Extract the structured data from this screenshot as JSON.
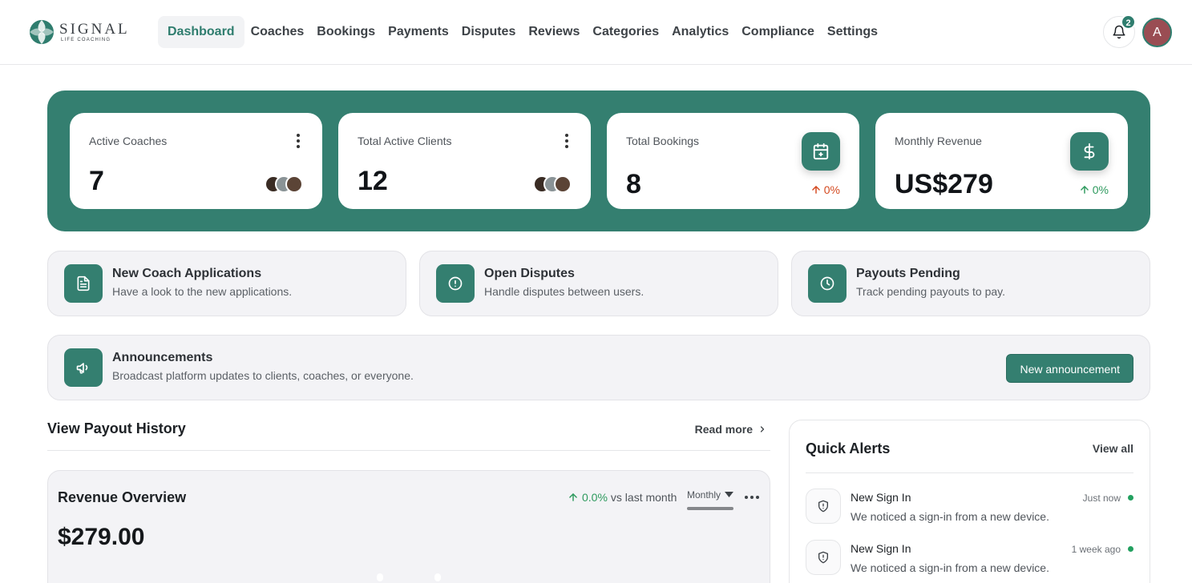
{
  "brand": {
    "name": "SIGNAL",
    "tagline": "LIFE COACHING"
  },
  "nav": {
    "items": [
      {
        "label": "Dashboard",
        "active": true
      },
      {
        "label": "Coaches"
      },
      {
        "label": "Bookings"
      },
      {
        "label": "Payments"
      },
      {
        "label": "Disputes"
      },
      {
        "label": "Reviews"
      },
      {
        "label": "Categories"
      },
      {
        "label": "Analytics"
      },
      {
        "label": "Compliance"
      },
      {
        "label": "Settings"
      }
    ]
  },
  "header": {
    "notifications_count": "2",
    "avatar_initial": "A",
    "accent_color": "#347f70"
  },
  "stats": [
    {
      "label": "Active Coaches",
      "value": "7",
      "kind": "avatars"
    },
    {
      "label": "Total Active Clients",
      "value": "12",
      "kind": "avatars"
    },
    {
      "label": "Total Bookings",
      "value": "8",
      "icon": "calendar-plus-icon",
      "delta": "0%",
      "delta_color": "#d4491f"
    },
    {
      "label": "Monthly Revenue",
      "value": "US$279",
      "icon": "dollar-icon",
      "delta": "0%",
      "delta_color": "#2e9a5e"
    }
  ],
  "actions": [
    {
      "title": "New Coach Applications",
      "description": "Have a look to the new applications.",
      "icon": "document-icon"
    },
    {
      "title": "Open Disputes",
      "description": "Handle disputes between users.",
      "icon": "alert-circle-icon"
    },
    {
      "title": "Payouts Pending",
      "description": "Track pending payouts to pay.",
      "icon": "clock-icon"
    }
  ],
  "announcements": {
    "title": "Announcements",
    "description": "Broadcast platform updates to clients, coaches, or everyone.",
    "button_label": "New announcement",
    "icon": "megaphone-icon"
  },
  "payout_history": {
    "title": "View Payout History",
    "link_label": "Read more"
  },
  "revenue_overview": {
    "title": "Revenue Overview",
    "amount": "$279.00",
    "delta": "0.0%",
    "delta_suffix": "vs last month",
    "period": "Monthly"
  },
  "quick_alerts": {
    "title": "Quick Alerts",
    "view_all_label": "View all",
    "items": [
      {
        "title": "New Sign In",
        "description": "We noticed a sign-in from a new device.",
        "time": "Just now",
        "icon": "shield-alert-icon"
      },
      {
        "title": "New Sign In",
        "description": "We noticed a sign-in from a new device.",
        "time": "1 week ago",
        "icon": "shield-alert-icon"
      }
    ]
  }
}
